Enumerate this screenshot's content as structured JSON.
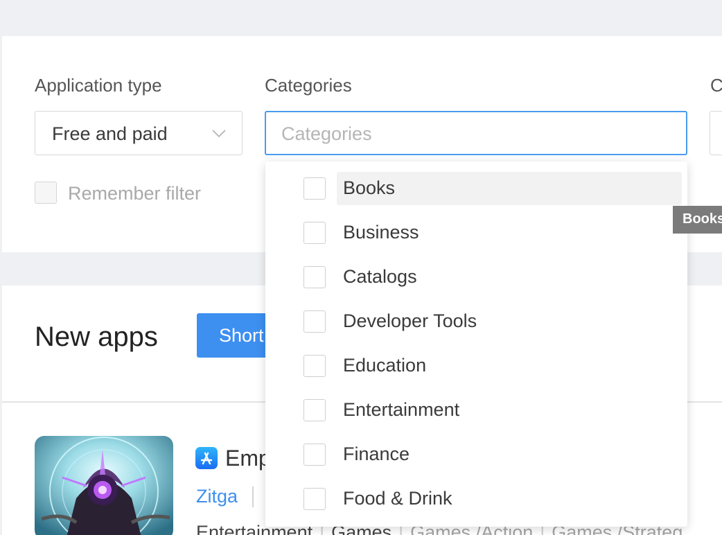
{
  "filters": {
    "application_type": {
      "label": "Application type",
      "value": "Free and paid"
    },
    "categories": {
      "label": "Categories",
      "placeholder": "Categories",
      "options": [
        {
          "label": "Books",
          "checked": false,
          "hovered": true
        },
        {
          "label": "Business",
          "checked": false
        },
        {
          "label": "Catalogs",
          "checked": false
        },
        {
          "label": "Developer Tools",
          "checked": false
        },
        {
          "label": "Education",
          "checked": false
        },
        {
          "label": "Entertainment",
          "checked": false
        },
        {
          "label": "Finance",
          "checked": false
        },
        {
          "label": "Food & Drink",
          "checked": false
        }
      ]
    },
    "third_filter_label": "C",
    "remember_filter": {
      "label": "Remember filter",
      "checked": false
    }
  },
  "tooltip": "Books",
  "section": {
    "title": "New apps",
    "short_button": "Short"
  },
  "app": {
    "title": "Emp",
    "developer": "Zitga",
    "categories": [
      {
        "text": "Entertainment",
        "style": "dark"
      },
      {
        "text": "Games",
        "style": "dark"
      },
      {
        "text": "Games /Action",
        "style": "mixed"
      },
      {
        "text": "Games /Strateg",
        "style": "mixed"
      }
    ]
  },
  "colors": {
    "accent": "#3d8ff0",
    "focus_border": "#4a9bf0",
    "page_bg": "#eff0f3"
  },
  "icons": {
    "select_chevron": "chevron-down-icon",
    "store": "app-store-icon"
  }
}
